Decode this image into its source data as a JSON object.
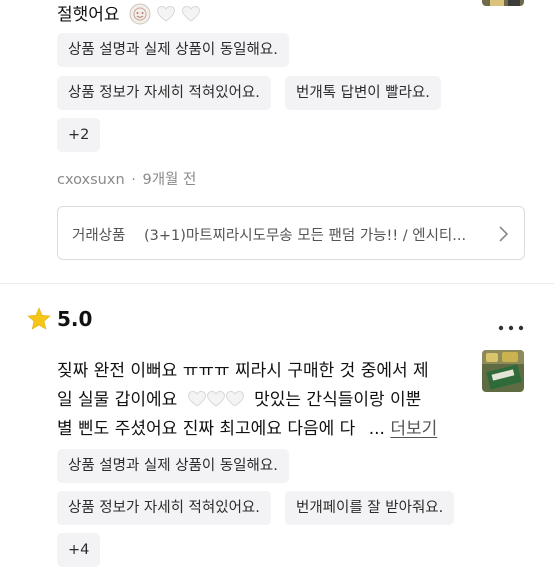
{
  "review1": {
    "text_tail": "절햇어요",
    "tags": [
      "상품 설명과 실제 상품이 동일해요.",
      "상품 정보가 자세히 적혀있어요.",
      "번개톡 답변이 빨라요."
    ],
    "more_tags": "+2",
    "author": "cxoxsuxn",
    "separator": "·",
    "time": "9개월 전",
    "product_box": {
      "label": "거래상품",
      "name": "(3+1)마트찌라시도무송 모든 팬덤 가능!! / 엔시티..."
    }
  },
  "review2": {
    "rating": "5.0",
    "text_line1": "짖짜 완전 이뻐요 ㅠㅠㅠ 찌라시 구매한 것 중에서 제",
    "text_line2a": "일 실물 갑이에요",
    "text_line2b": "맛있는 간식들이랑 이뿐",
    "text_line3": "별 삔도 주셨어요 진짜 최고에요 다음에 다",
    "ellipsis": "...",
    "more_link": "더보기",
    "tags": [
      "상품 설명과 실제 상품이 동일해요.",
      "상품 정보가 자세히 적혀있어요.",
      "번개페이를 잘 받아줘요."
    ],
    "more_tags": "+4"
  },
  "colors": {
    "accent_star": "#f5c518",
    "tag_bg": "#f3f3f5",
    "muted": "#8a8a8a",
    "link": "#555555"
  },
  "icons": [
    "smile-emoji-icon",
    "white-heart-icon",
    "star-icon",
    "more-dots-icon",
    "chevron-right-icon"
  ]
}
